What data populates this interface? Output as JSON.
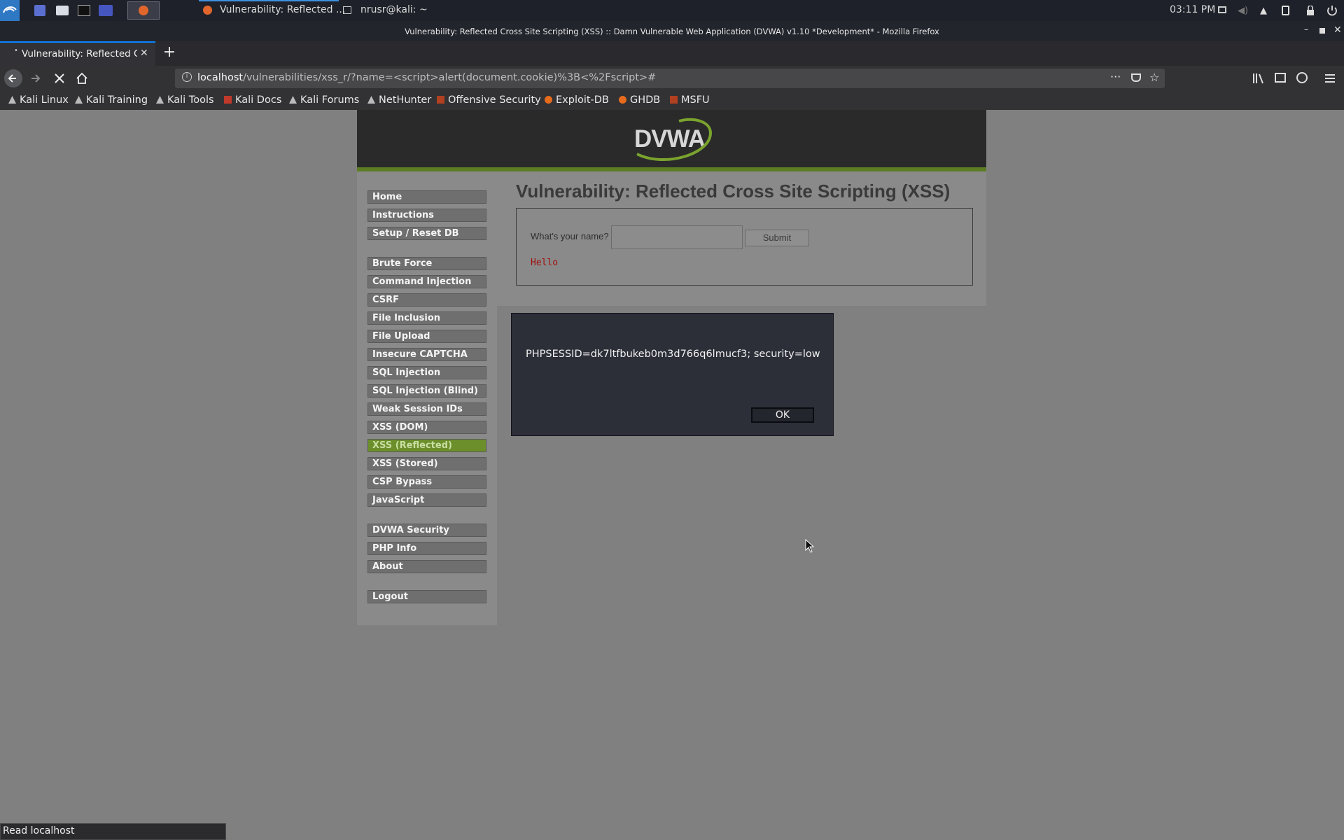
{
  "panel": {
    "clock": "03:11 PM",
    "tasks": [
      {
        "label": "Vulnerability: Reflected ..."
      },
      {
        "label": "nrusr@kali: ~"
      }
    ]
  },
  "window": {
    "title": "Vulnerability: Reflected Cross Site Scripting (XSS) :: Damn Vulnerable Web Application (DVWA) v1.10 *Development* - Mozilla Firefox"
  },
  "browser": {
    "tab_title": "Vulnerability: Reflected C",
    "url_host": "localhost",
    "url_path": "/vulnerabilities/xss_r/?name=<script>alert(document.cookie)%3B<%2Fscript>#",
    "bookmarks": [
      "Kali Linux",
      "Kali Training",
      "Kali Tools",
      "Kali Docs",
      "Kali Forums",
      "NetHunter",
      "Offensive Security",
      "Exploit-DB",
      "GHDB",
      "MSFU"
    ],
    "status": "Read localhost"
  },
  "dvwa": {
    "logo": "DVWA",
    "menu_group1": [
      "Home",
      "Instructions",
      "Setup / Reset DB"
    ],
    "menu_group2": [
      "Brute Force",
      "Command Injection",
      "CSRF",
      "File Inclusion",
      "File Upload",
      "Insecure CAPTCHA",
      "SQL Injection",
      "SQL Injection (Blind)",
      "Weak Session IDs",
      "XSS (DOM)",
      "XSS (Reflected)",
      "XSS (Stored)",
      "CSP Bypass",
      "JavaScript"
    ],
    "menu_group3": [
      "DVWA Security",
      "PHP Info",
      "About"
    ],
    "menu_group4": [
      "Logout"
    ],
    "active_item": "XSS (Reflected)",
    "page_title": "Vulnerability: Reflected Cross Site Scripting (XSS)",
    "form": {
      "label": "What's your name?",
      "input_value": "",
      "submit_label": "Submit",
      "output": "Hello"
    }
  },
  "alert": {
    "message": "PHPSESSID=dk7ltfbukeb0m3d766q6lmucf3; security=low",
    "ok_label": "OK"
  },
  "colors": {
    "dvwa_green": "#6c8e2b",
    "tab_accent": "#0a84ff"
  }
}
